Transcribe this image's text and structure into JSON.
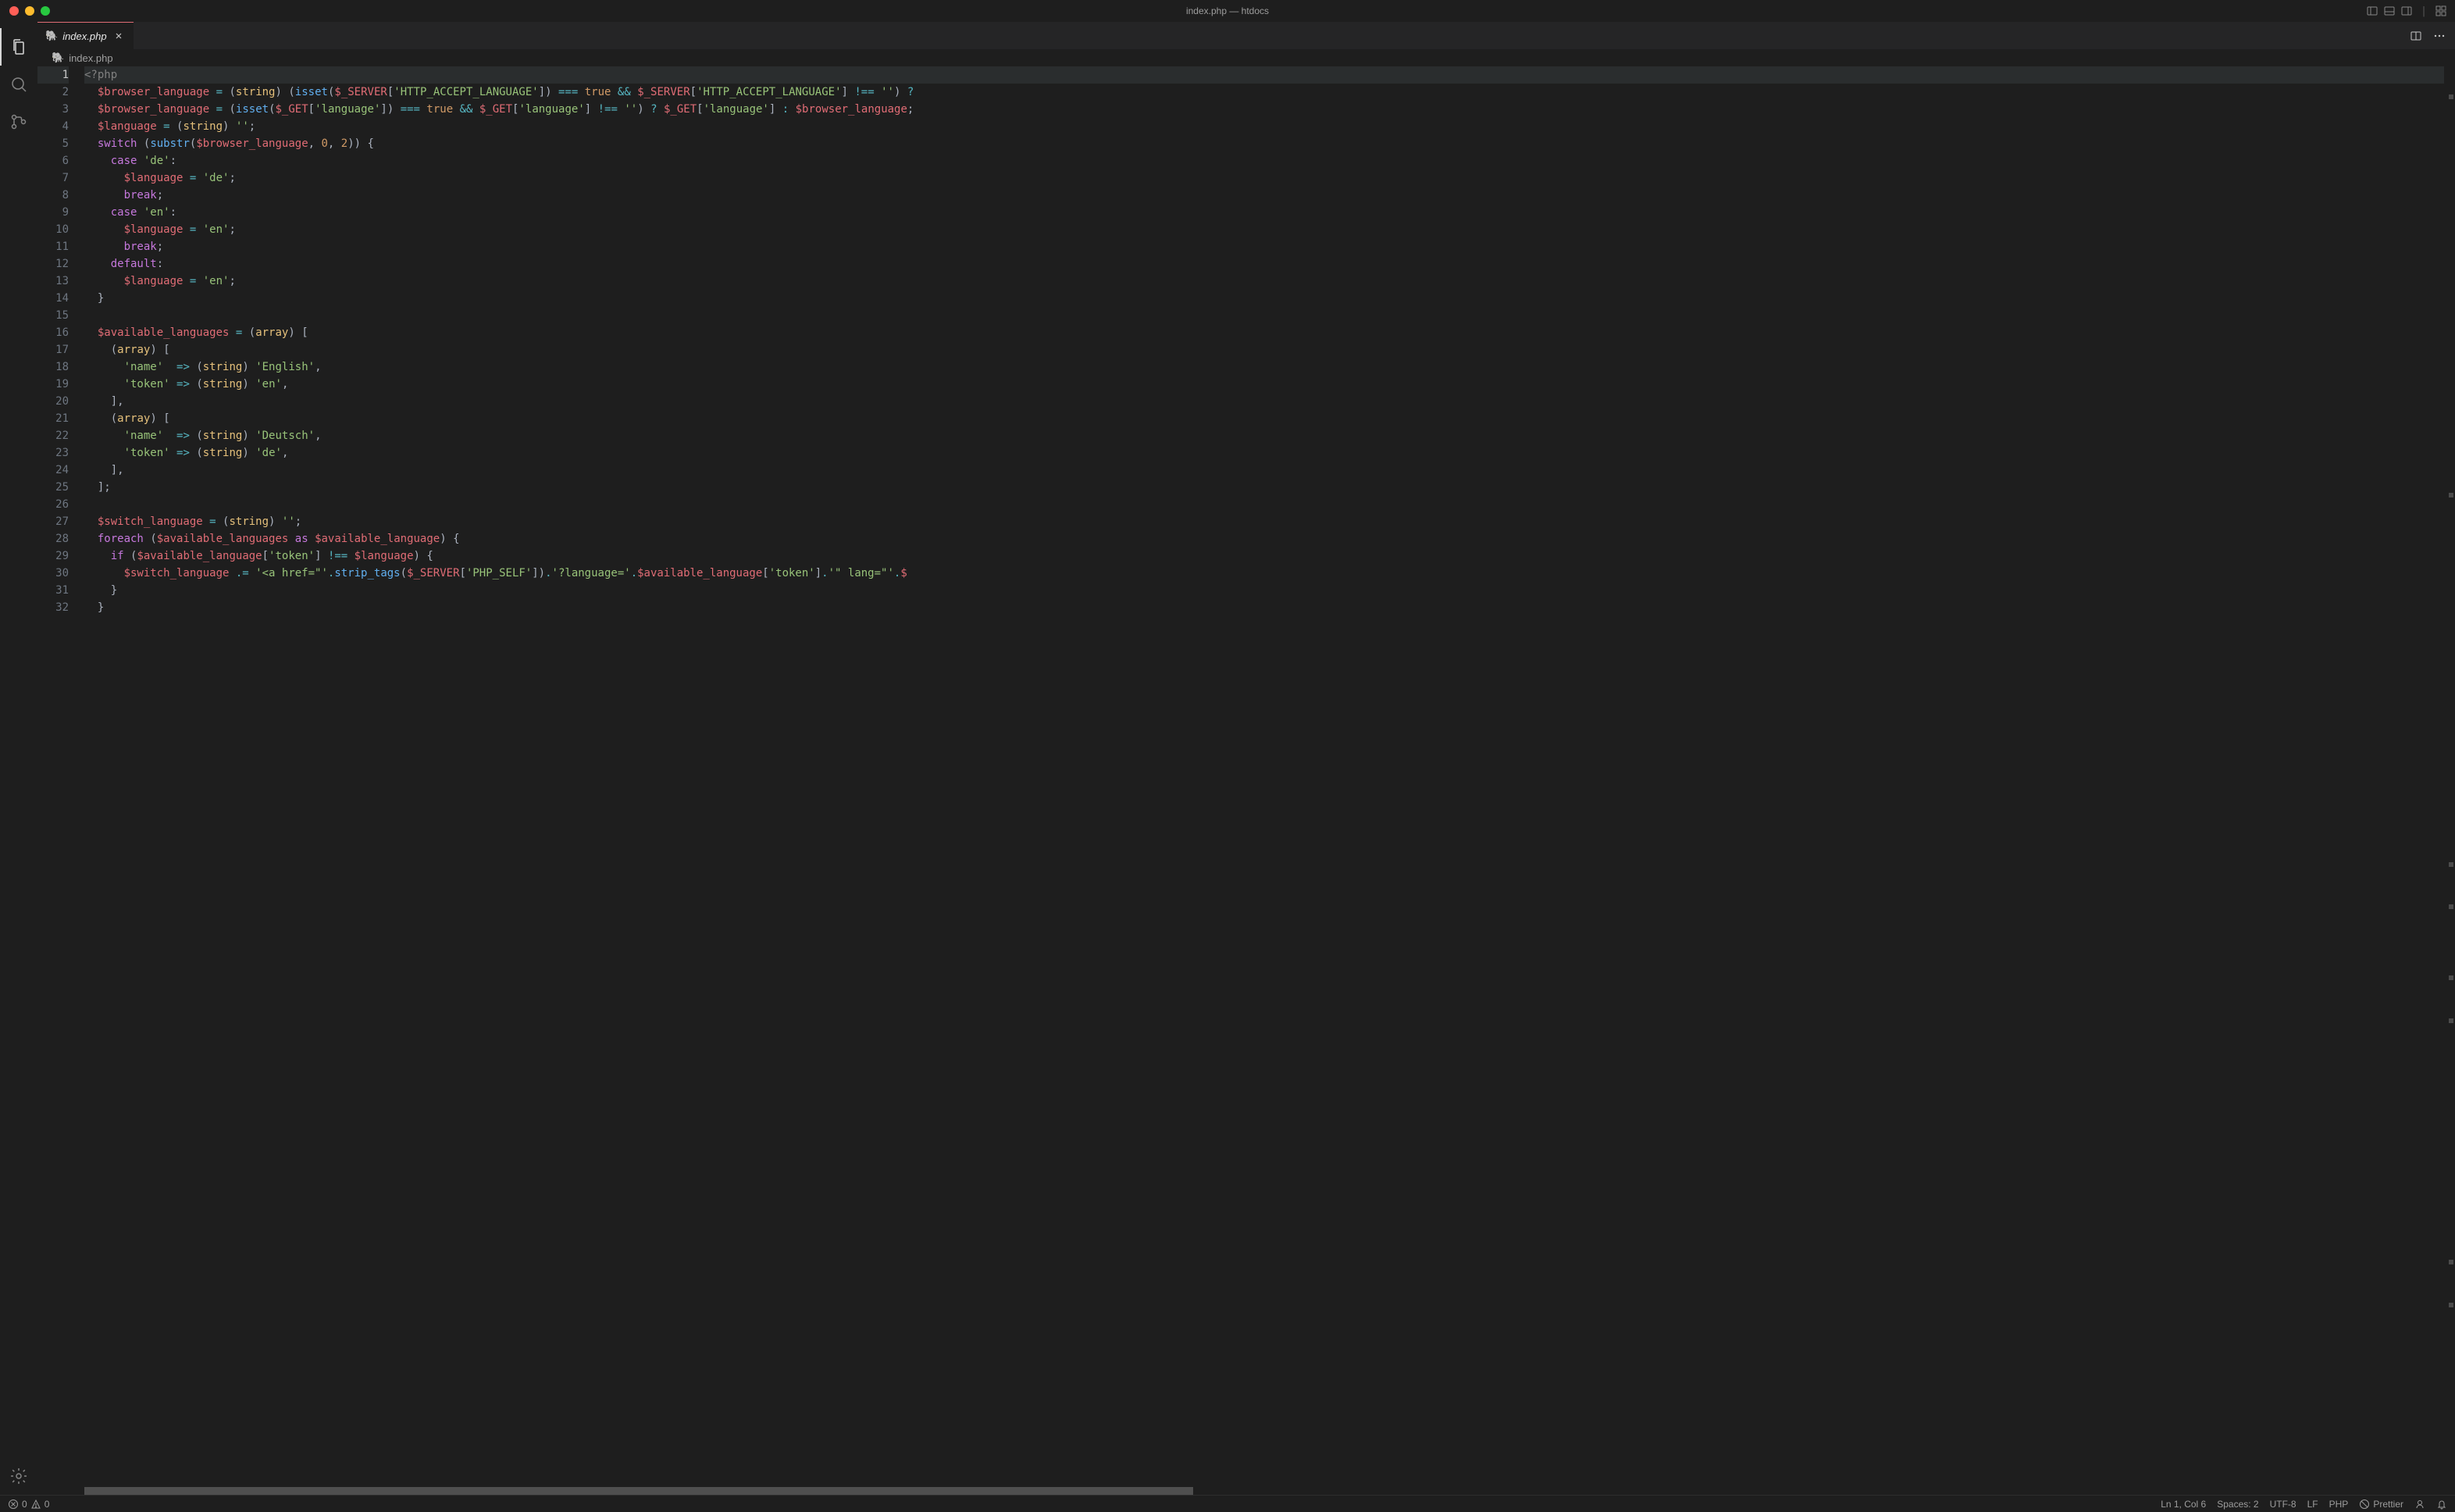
{
  "window": {
    "title": "index.php — htdocs"
  },
  "tab": {
    "icon": "🐘",
    "label": "index.php"
  },
  "breadcrumb": {
    "icon": "🐘",
    "label": "index.php"
  },
  "status": {
    "errors": "0",
    "warnings": "0",
    "ln_col": "Ln 1, Col 6",
    "spaces": "Spaces: 2",
    "encoding": "UTF-8",
    "eol": "LF",
    "language": "PHP",
    "prettier": "Prettier"
  },
  "code": {
    "lines": [
      [
        {
          "t": "<?php",
          "c": "c-tag"
        }
      ],
      [
        {
          "t": "  ",
          "c": "c-indent"
        },
        {
          "t": "$browser_language",
          "c": "c-var"
        },
        {
          "t": " ",
          "c": ""
        },
        {
          "t": "=",
          "c": "c-op"
        },
        {
          "t": " ",
          "c": ""
        },
        {
          "t": "(",
          "c": "c-pun"
        },
        {
          "t": "string",
          "c": "c-type"
        },
        {
          "t": ")",
          "c": "c-pun"
        },
        {
          "t": " ",
          "c": ""
        },
        {
          "t": "(",
          "c": "c-pun"
        },
        {
          "t": "isset",
          "c": "c-fn"
        },
        {
          "t": "(",
          "c": "c-pun"
        },
        {
          "t": "$_SERVER",
          "c": "c-var"
        },
        {
          "t": "[",
          "c": "c-pun"
        },
        {
          "t": "'HTTP_ACCEPT_LANGUAGE'",
          "c": "c-str"
        },
        {
          "t": "])",
          "c": "c-pun"
        },
        {
          "t": " ",
          "c": ""
        },
        {
          "t": "===",
          "c": "c-op"
        },
        {
          "t": " ",
          "c": ""
        },
        {
          "t": "true",
          "c": "c-const"
        },
        {
          "t": " ",
          "c": ""
        },
        {
          "t": "&&",
          "c": "c-op"
        },
        {
          "t": " ",
          "c": ""
        },
        {
          "t": "$_SERVER",
          "c": "c-var"
        },
        {
          "t": "[",
          "c": "c-pun"
        },
        {
          "t": "'HTTP_ACCEPT_LANGUAGE'",
          "c": "c-str"
        },
        {
          "t": "]",
          "c": "c-pun"
        },
        {
          "t": " ",
          "c": ""
        },
        {
          "t": "!==",
          "c": "c-op"
        },
        {
          "t": " ",
          "c": ""
        },
        {
          "t": "''",
          "c": "c-str"
        },
        {
          "t": ")",
          "c": "c-pun"
        },
        {
          "t": " ",
          "c": ""
        },
        {
          "t": "?",
          "c": "c-op"
        }
      ],
      [
        {
          "t": "  ",
          "c": "c-indent"
        },
        {
          "t": "$browser_language",
          "c": "c-var"
        },
        {
          "t": " ",
          "c": ""
        },
        {
          "t": "=",
          "c": "c-op"
        },
        {
          "t": " ",
          "c": ""
        },
        {
          "t": "(",
          "c": "c-pun"
        },
        {
          "t": "isset",
          "c": "c-fn"
        },
        {
          "t": "(",
          "c": "c-pun"
        },
        {
          "t": "$_GET",
          "c": "c-var"
        },
        {
          "t": "[",
          "c": "c-pun"
        },
        {
          "t": "'language'",
          "c": "c-str"
        },
        {
          "t": "])",
          "c": "c-pun"
        },
        {
          "t": " ",
          "c": ""
        },
        {
          "t": "===",
          "c": "c-op"
        },
        {
          "t": " ",
          "c": ""
        },
        {
          "t": "true",
          "c": "c-const"
        },
        {
          "t": " ",
          "c": ""
        },
        {
          "t": "&&",
          "c": "c-op"
        },
        {
          "t": " ",
          "c": ""
        },
        {
          "t": "$_GET",
          "c": "c-var"
        },
        {
          "t": "[",
          "c": "c-pun"
        },
        {
          "t": "'language'",
          "c": "c-str"
        },
        {
          "t": "]",
          "c": "c-pun"
        },
        {
          "t": " ",
          "c": ""
        },
        {
          "t": "!==",
          "c": "c-op"
        },
        {
          "t": " ",
          "c": ""
        },
        {
          "t": "''",
          "c": "c-str"
        },
        {
          "t": ")",
          "c": "c-pun"
        },
        {
          "t": " ",
          "c": ""
        },
        {
          "t": "?",
          "c": "c-op"
        },
        {
          "t": " ",
          "c": ""
        },
        {
          "t": "$_GET",
          "c": "c-var"
        },
        {
          "t": "[",
          "c": "c-pun"
        },
        {
          "t": "'language'",
          "c": "c-str"
        },
        {
          "t": "]",
          "c": "c-pun"
        },
        {
          "t": " ",
          "c": ""
        },
        {
          "t": ":",
          "c": "c-op"
        },
        {
          "t": " ",
          "c": ""
        },
        {
          "t": "$browser_language",
          "c": "c-var"
        },
        {
          "t": ";",
          "c": "c-pun"
        }
      ],
      [
        {
          "t": "  ",
          "c": "c-indent"
        },
        {
          "t": "$language",
          "c": "c-var"
        },
        {
          "t": " ",
          "c": ""
        },
        {
          "t": "=",
          "c": "c-op"
        },
        {
          "t": " ",
          "c": ""
        },
        {
          "t": "(",
          "c": "c-pun"
        },
        {
          "t": "string",
          "c": "c-type"
        },
        {
          "t": ")",
          "c": "c-pun"
        },
        {
          "t": " ",
          "c": ""
        },
        {
          "t": "''",
          "c": "c-str"
        },
        {
          "t": ";",
          "c": "c-pun"
        }
      ],
      [
        {
          "t": "  ",
          "c": "c-indent"
        },
        {
          "t": "switch",
          "c": "c-kw"
        },
        {
          "t": " ",
          "c": ""
        },
        {
          "t": "(",
          "c": "c-pun"
        },
        {
          "t": "substr",
          "c": "c-fn"
        },
        {
          "t": "(",
          "c": "c-pun"
        },
        {
          "t": "$browser_language",
          "c": "c-var"
        },
        {
          "t": ", ",
          "c": "c-pun"
        },
        {
          "t": "0",
          "c": "c-num"
        },
        {
          "t": ", ",
          "c": "c-pun"
        },
        {
          "t": "2",
          "c": "c-num"
        },
        {
          "t": "))",
          "c": "c-pun"
        },
        {
          "t": " ",
          "c": ""
        },
        {
          "t": "{",
          "c": "c-pun"
        }
      ],
      [
        {
          "t": "    ",
          "c": "c-indent"
        },
        {
          "t": "case",
          "c": "c-kw"
        },
        {
          "t": " ",
          "c": ""
        },
        {
          "t": "'de'",
          "c": "c-str"
        },
        {
          "t": ":",
          "c": "c-pun"
        }
      ],
      [
        {
          "t": "      ",
          "c": "c-indent"
        },
        {
          "t": "$language",
          "c": "c-var"
        },
        {
          "t": " ",
          "c": ""
        },
        {
          "t": "=",
          "c": "c-op"
        },
        {
          "t": " ",
          "c": ""
        },
        {
          "t": "'de'",
          "c": "c-str"
        },
        {
          "t": ";",
          "c": "c-pun"
        }
      ],
      [
        {
          "t": "      ",
          "c": "c-indent"
        },
        {
          "t": "break",
          "c": "c-kw"
        },
        {
          "t": ";",
          "c": "c-pun"
        }
      ],
      [
        {
          "t": "    ",
          "c": "c-indent"
        },
        {
          "t": "case",
          "c": "c-kw"
        },
        {
          "t": " ",
          "c": ""
        },
        {
          "t": "'en'",
          "c": "c-str"
        },
        {
          "t": ":",
          "c": "c-pun"
        }
      ],
      [
        {
          "t": "      ",
          "c": "c-indent"
        },
        {
          "t": "$language",
          "c": "c-var"
        },
        {
          "t": " ",
          "c": ""
        },
        {
          "t": "=",
          "c": "c-op"
        },
        {
          "t": " ",
          "c": ""
        },
        {
          "t": "'en'",
          "c": "c-str"
        },
        {
          "t": ";",
          "c": "c-pun"
        }
      ],
      [
        {
          "t": "      ",
          "c": "c-indent"
        },
        {
          "t": "break",
          "c": "c-kw"
        },
        {
          "t": ";",
          "c": "c-pun"
        }
      ],
      [
        {
          "t": "    ",
          "c": "c-indent"
        },
        {
          "t": "default",
          "c": "c-kw"
        },
        {
          "t": ":",
          "c": "c-pun"
        }
      ],
      [
        {
          "t": "      ",
          "c": "c-indent"
        },
        {
          "t": "$language",
          "c": "c-var"
        },
        {
          "t": " ",
          "c": ""
        },
        {
          "t": "=",
          "c": "c-op"
        },
        {
          "t": " ",
          "c": ""
        },
        {
          "t": "'en'",
          "c": "c-str"
        },
        {
          "t": ";",
          "c": "c-pun"
        }
      ],
      [
        {
          "t": "  ",
          "c": "c-indent"
        },
        {
          "t": "}",
          "c": "c-pun"
        }
      ],
      [],
      [
        {
          "t": "  ",
          "c": "c-indent"
        },
        {
          "t": "$available_languages",
          "c": "c-var"
        },
        {
          "t": " ",
          "c": ""
        },
        {
          "t": "=",
          "c": "c-op"
        },
        {
          "t": " ",
          "c": ""
        },
        {
          "t": "(",
          "c": "c-pun"
        },
        {
          "t": "array",
          "c": "c-type"
        },
        {
          "t": ")",
          "c": "c-pun"
        },
        {
          "t": " ",
          "c": ""
        },
        {
          "t": "[",
          "c": "c-pun"
        }
      ],
      [
        {
          "t": "    ",
          "c": "c-indent"
        },
        {
          "t": "(",
          "c": "c-pun"
        },
        {
          "t": "array",
          "c": "c-type"
        },
        {
          "t": ")",
          "c": "c-pun"
        },
        {
          "t": " ",
          "c": ""
        },
        {
          "t": "[",
          "c": "c-pun"
        }
      ],
      [
        {
          "t": "      ",
          "c": "c-indent"
        },
        {
          "t": "'name'",
          "c": "c-str"
        },
        {
          "t": "  ",
          "c": ""
        },
        {
          "t": "=>",
          "c": "c-op"
        },
        {
          "t": " ",
          "c": ""
        },
        {
          "t": "(",
          "c": "c-pun"
        },
        {
          "t": "string",
          "c": "c-type"
        },
        {
          "t": ")",
          "c": "c-pun"
        },
        {
          "t": " ",
          "c": ""
        },
        {
          "t": "'English'",
          "c": "c-str"
        },
        {
          "t": ",",
          "c": "c-pun"
        }
      ],
      [
        {
          "t": "      ",
          "c": "c-indent"
        },
        {
          "t": "'token'",
          "c": "c-str"
        },
        {
          "t": " ",
          "c": ""
        },
        {
          "t": "=>",
          "c": "c-op"
        },
        {
          "t": " ",
          "c": ""
        },
        {
          "t": "(",
          "c": "c-pun"
        },
        {
          "t": "string",
          "c": "c-type"
        },
        {
          "t": ")",
          "c": "c-pun"
        },
        {
          "t": " ",
          "c": ""
        },
        {
          "t": "'en'",
          "c": "c-str"
        },
        {
          "t": ",",
          "c": "c-pun"
        }
      ],
      [
        {
          "t": "    ",
          "c": "c-indent"
        },
        {
          "t": "],",
          "c": "c-pun"
        }
      ],
      [
        {
          "t": "    ",
          "c": "c-indent"
        },
        {
          "t": "(",
          "c": "c-pun"
        },
        {
          "t": "array",
          "c": "c-type"
        },
        {
          "t": ")",
          "c": "c-pun"
        },
        {
          "t": " ",
          "c": ""
        },
        {
          "t": "[",
          "c": "c-pun"
        }
      ],
      [
        {
          "t": "      ",
          "c": "c-indent"
        },
        {
          "t": "'name'",
          "c": "c-str"
        },
        {
          "t": "  ",
          "c": ""
        },
        {
          "t": "=>",
          "c": "c-op"
        },
        {
          "t": " ",
          "c": ""
        },
        {
          "t": "(",
          "c": "c-pun"
        },
        {
          "t": "string",
          "c": "c-type"
        },
        {
          "t": ")",
          "c": "c-pun"
        },
        {
          "t": " ",
          "c": ""
        },
        {
          "t": "'Deutsch'",
          "c": "c-str"
        },
        {
          "t": ",",
          "c": "c-pun"
        }
      ],
      [
        {
          "t": "      ",
          "c": "c-indent"
        },
        {
          "t": "'token'",
          "c": "c-str"
        },
        {
          "t": " ",
          "c": ""
        },
        {
          "t": "=>",
          "c": "c-op"
        },
        {
          "t": " ",
          "c": ""
        },
        {
          "t": "(",
          "c": "c-pun"
        },
        {
          "t": "string",
          "c": "c-type"
        },
        {
          "t": ")",
          "c": "c-pun"
        },
        {
          "t": " ",
          "c": ""
        },
        {
          "t": "'de'",
          "c": "c-str"
        },
        {
          "t": ",",
          "c": "c-pun"
        }
      ],
      [
        {
          "t": "    ",
          "c": "c-indent"
        },
        {
          "t": "],",
          "c": "c-pun"
        }
      ],
      [
        {
          "t": "  ",
          "c": "c-indent"
        },
        {
          "t": "];",
          "c": "c-pun"
        }
      ],
      [],
      [
        {
          "t": "  ",
          "c": "c-indent"
        },
        {
          "t": "$switch_language",
          "c": "c-var"
        },
        {
          "t": " ",
          "c": ""
        },
        {
          "t": "=",
          "c": "c-op"
        },
        {
          "t": " ",
          "c": ""
        },
        {
          "t": "(",
          "c": "c-pun"
        },
        {
          "t": "string",
          "c": "c-type"
        },
        {
          "t": ")",
          "c": "c-pun"
        },
        {
          "t": " ",
          "c": ""
        },
        {
          "t": "''",
          "c": "c-str"
        },
        {
          "t": ";",
          "c": "c-pun"
        }
      ],
      [
        {
          "t": "  ",
          "c": "c-indent"
        },
        {
          "t": "foreach",
          "c": "c-kw"
        },
        {
          "t": " ",
          "c": ""
        },
        {
          "t": "(",
          "c": "c-pun"
        },
        {
          "t": "$available_languages",
          "c": "c-var"
        },
        {
          "t": " ",
          "c": ""
        },
        {
          "t": "as",
          "c": "c-kw"
        },
        {
          "t": " ",
          "c": ""
        },
        {
          "t": "$available_language",
          "c": "c-var"
        },
        {
          "t": ")",
          "c": "c-pun"
        },
        {
          "t": " ",
          "c": ""
        },
        {
          "t": "{",
          "c": "c-pun"
        }
      ],
      [
        {
          "t": "    ",
          "c": "c-indent"
        },
        {
          "t": "if",
          "c": "c-kw"
        },
        {
          "t": " ",
          "c": ""
        },
        {
          "t": "(",
          "c": "c-pun"
        },
        {
          "t": "$available_language",
          "c": "c-var"
        },
        {
          "t": "[",
          "c": "c-pun"
        },
        {
          "t": "'token'",
          "c": "c-str"
        },
        {
          "t": "]",
          "c": "c-pun"
        },
        {
          "t": " ",
          "c": ""
        },
        {
          "t": "!==",
          "c": "c-op"
        },
        {
          "t": " ",
          "c": ""
        },
        {
          "t": "$language",
          "c": "c-var"
        },
        {
          "t": ")",
          "c": "c-pun"
        },
        {
          "t": " ",
          "c": ""
        },
        {
          "t": "{",
          "c": "c-pun"
        }
      ],
      [
        {
          "t": "      ",
          "c": "c-indent"
        },
        {
          "t": "$switch_language",
          "c": "c-var"
        },
        {
          "t": " ",
          "c": ""
        },
        {
          "t": ".=",
          "c": "c-op"
        },
        {
          "t": " ",
          "c": ""
        },
        {
          "t": "'<a href=\"'",
          "c": "c-str"
        },
        {
          "t": ".",
          "c": "c-op"
        },
        {
          "t": "strip_tags",
          "c": "c-fn"
        },
        {
          "t": "(",
          "c": "c-pun"
        },
        {
          "t": "$_SERVER",
          "c": "c-var"
        },
        {
          "t": "[",
          "c": "c-pun"
        },
        {
          "t": "'PHP_SELF'",
          "c": "c-str"
        },
        {
          "t": "])",
          "c": "c-pun"
        },
        {
          "t": ".",
          "c": "c-op"
        },
        {
          "t": "'?language='",
          "c": "c-str"
        },
        {
          "t": ".",
          "c": "c-op"
        },
        {
          "t": "$available_language",
          "c": "c-var"
        },
        {
          "t": "[",
          "c": "c-pun"
        },
        {
          "t": "'token'",
          "c": "c-str"
        },
        {
          "t": "]",
          "c": "c-pun"
        },
        {
          "t": ".",
          "c": "c-op"
        },
        {
          "t": "'\" lang=\"'",
          "c": "c-str"
        },
        {
          "t": ".",
          "c": "c-op"
        },
        {
          "t": "$",
          "c": "c-var"
        }
      ],
      [
        {
          "t": "    ",
          "c": "c-indent"
        },
        {
          "t": "}",
          "c": "c-pun"
        }
      ],
      [
        {
          "t": "  ",
          "c": "c-indent"
        },
        {
          "t": "}",
          "c": "c-pun"
        }
      ]
    ]
  }
}
